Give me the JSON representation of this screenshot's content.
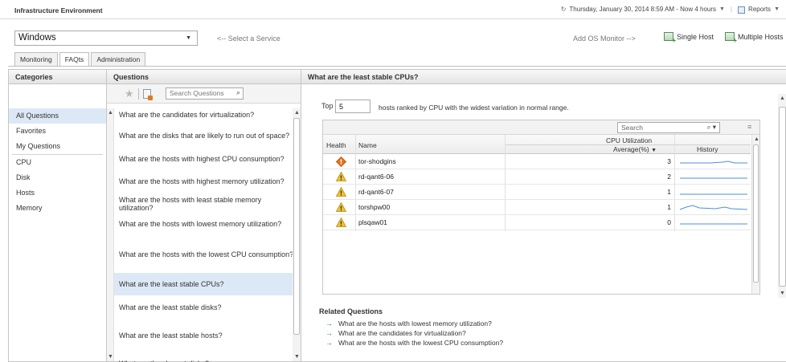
{
  "app": {
    "title": "Infrastructure Environment"
  },
  "topbar": {
    "time_prefix_icon": "clock-icon",
    "time_range": "Thursday, January 30, 2014 8:59 AM - Now 4 hours",
    "reports_label": "Reports"
  },
  "service": {
    "selected": "Windows",
    "hint": "<-- Select a Service",
    "add_os_label": "Add OS Monitor -->",
    "single_host_label": "Single Host",
    "multiple_hosts_label": "Multiple Hosts"
  },
  "tabs": [
    {
      "label": "Monitoring",
      "active": false
    },
    {
      "label": "FAQts",
      "active": true
    },
    {
      "label": "Administration",
      "active": false
    }
  ],
  "categories": {
    "header": "Categories",
    "groups": [
      [
        "All Questions",
        "Favorites",
        "My Questions"
      ],
      [
        "CPU",
        "Disk",
        "Hosts",
        "Memory"
      ]
    ],
    "selected": "All Questions"
  },
  "questions": {
    "header": "Questions",
    "search_placeholder": "Search Questions",
    "items": [
      "What are the candidates for virtualization?",
      "What are the disks that are likely to run out of space?",
      "What are the hosts with highest CPU consumption?",
      "What are the hosts with highest memory utilization?",
      "What are the hosts with least stable memory utilization?",
      "What are the hosts with lowest memory utilization?",
      "What are the hosts with the lowest CPU consumption?",
      "What are the least stable CPUs?",
      "What are the least stable disks?",
      "What are the least stable hosts?",
      "What are the slowest disks?"
    ],
    "selected_index": 7
  },
  "detail": {
    "title": "What are the least stable CPUs?",
    "top_label": "Top",
    "top_value": "5",
    "description": "hosts ranked by CPU with the widest variation in normal range.",
    "grid": {
      "search_placeholder": "Search",
      "columns": {
        "health": "Health",
        "name": "Name",
        "group": "CPU Utilization",
        "average": "Average(%)",
        "history": "History"
      },
      "rows": [
        {
          "health": "critical",
          "name": "tor-shodgins",
          "average": "3"
        },
        {
          "health": "warning",
          "name": "rd-qant6-06",
          "average": "2"
        },
        {
          "health": "warning",
          "name": "rd-qant6-07",
          "average": "1"
        },
        {
          "health": "warning",
          "name": "torshpw00",
          "average": "1"
        },
        {
          "health": "warning",
          "name": "plsqaw01",
          "average": "0"
        }
      ]
    },
    "related": {
      "title": "Related Questions",
      "items": [
        "What are the hosts with lowest memory utilization?",
        "What are the candidates for virtualization?",
        "What are the hosts with the lowest CPU consumption?"
      ]
    }
  },
  "colors": {
    "selection": "#dce8f5",
    "warning": "#f2c230",
    "critical": "#e8731c",
    "sparkline": "#4a90d9",
    "link_arrow": "#2b6cb0"
  }
}
